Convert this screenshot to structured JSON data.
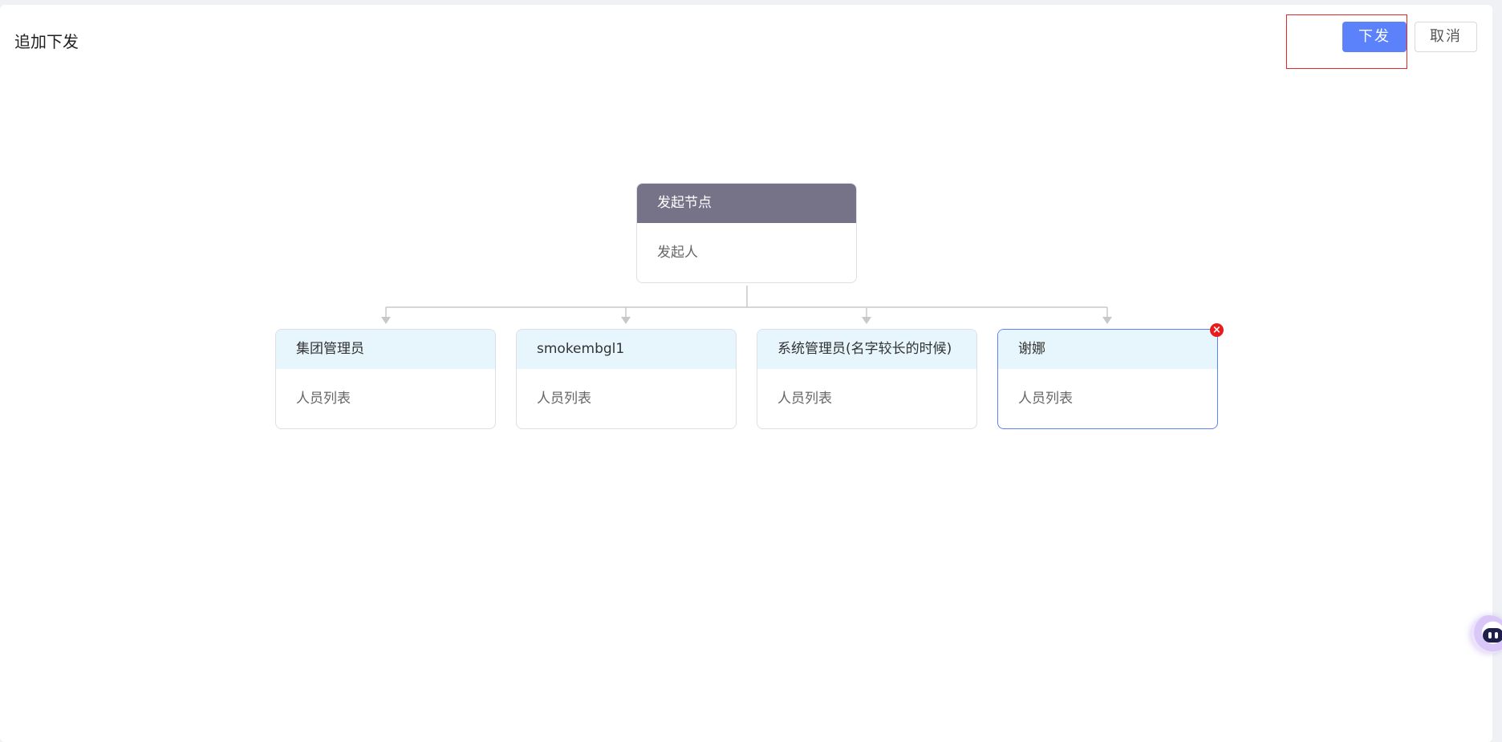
{
  "header": {
    "title": "追加下发",
    "submit_label": "下发",
    "cancel_label": "取消"
  },
  "tree": {
    "root": {
      "title": "发起节点",
      "subtitle": "发起人"
    },
    "children": [
      {
        "title": "集团管理员",
        "subtitle": "人员列表",
        "selected": false
      },
      {
        "title": "smokembgl1",
        "subtitle": "人员列表",
        "selected": false
      },
      {
        "title": "系统管理员(名字较长的时候)",
        "subtitle": "人员列表",
        "selected": false
      },
      {
        "title": "谢娜",
        "subtitle": "人员列表",
        "selected": true
      }
    ]
  },
  "icons": {
    "remove": "close-icon",
    "assistant": "robot-assistant-icon",
    "arrow": "arrow-down-icon"
  },
  "colors": {
    "primary": "#5b82fb",
    "root_header": "#767288",
    "child_header": "#e7f5fc",
    "remove_badge": "#e81c1c",
    "highlight": "#e02a2a"
  }
}
